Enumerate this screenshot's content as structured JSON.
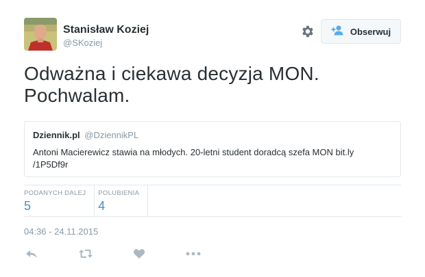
{
  "author": {
    "name": "Stanisław Koziej",
    "handle": "@SKoziej",
    "avatar_icon": "profile-photo"
  },
  "header": {
    "settings_icon": "gear-icon",
    "follow_icon": "add-user-icon",
    "follow_label": "Obserwuj"
  },
  "tweet": {
    "text_line1": "Odważna i ciekawa decyzja MON.",
    "text_line2": "Pochwalam."
  },
  "quote": {
    "name": "Dziennik.pl",
    "handle": "@DziennikPL",
    "text": "Antoni Macierewicz stawia na młodych. 20-letni student doradcą szefa MON bit.ly /1P5Df9r"
  },
  "stats": {
    "retweets_label": "PODANYCH DALEJ",
    "retweets_value": "5",
    "likes_label": "POLUBIENIA",
    "likes_value": "4"
  },
  "timestamp": "04:36 - 24.11.2015",
  "actions": {
    "reply_icon": "reply-icon",
    "retweet_icon": "retweet-icon",
    "like_icon": "heart-icon",
    "more_icon": "more-icon"
  },
  "colors": {
    "text": "#292f33",
    "muted": "#8899a6",
    "stat_value": "#4a90c2",
    "border": "#e1e8ed",
    "icon": "#aab8c2"
  }
}
